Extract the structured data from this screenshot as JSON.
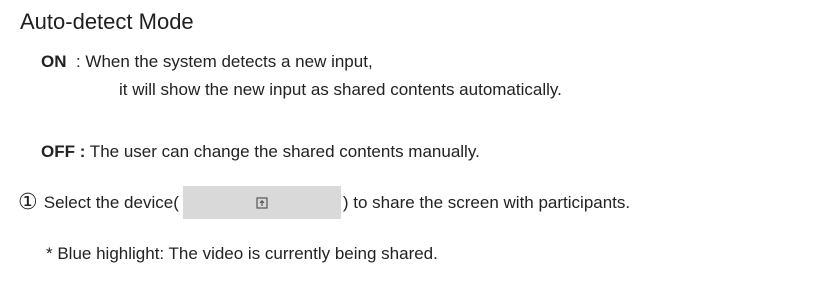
{
  "title": "Auto-detect Mode",
  "on": {
    "label": "ON",
    "sep": "  : ",
    "line1": "When the system detects a new input,",
    "line2": "it will show the new input as shared contents automatically."
  },
  "off": {
    "label": "OFF :",
    "text": " The user can change the shared contents manually."
  },
  "step": {
    "number": "①",
    "before": "Select the device(",
    "after": ") to share the screen with participants.",
    "device_icon": "share-screen-icon"
  },
  "note": "* Blue highlight: The video is currently being shared.",
  "colors": {
    "device_button_bg": "#d9d9d9",
    "text": "#222222"
  }
}
